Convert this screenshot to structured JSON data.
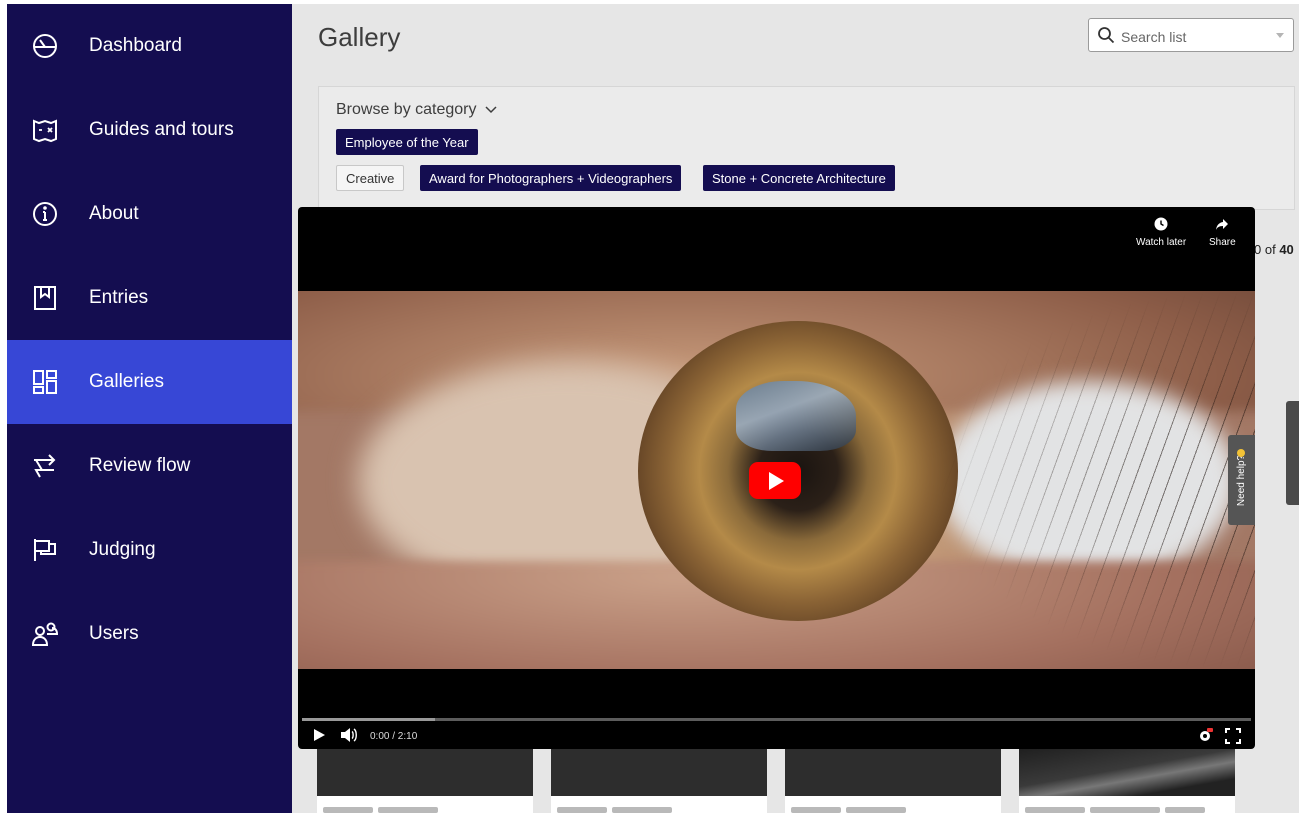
{
  "sidebar": {
    "items": [
      {
        "label": "Dashboard",
        "icon": "dashboard-gauge-icon",
        "active": false
      },
      {
        "label": "Guides and tours",
        "icon": "map-guide-icon",
        "active": false
      },
      {
        "label": "About",
        "icon": "info-circle-icon",
        "active": false
      },
      {
        "label": "Entries",
        "icon": "bookmark-entries-icon",
        "active": false
      },
      {
        "label": "Galleries",
        "icon": "grid-gallery-icon",
        "active": true
      },
      {
        "label": "Review flow",
        "icon": "review-flow-arrows-icon",
        "active": false
      },
      {
        "label": "Judging",
        "icon": "flag-icon",
        "active": false
      },
      {
        "label": "Users",
        "icon": "users-icon",
        "active": false
      }
    ],
    "colors": {
      "background": "#140d50",
      "active": "#3747d6"
    }
  },
  "header": {
    "title": "Gallery",
    "search_placeholder": "Search list"
  },
  "filters": {
    "browse_label": "Browse by category",
    "tags": [
      {
        "label": "Employee of the Year",
        "selected": true
      },
      {
        "label": "Creative",
        "selected": false
      },
      {
        "label": "Award for Photographers + Videographers",
        "selected": true
      },
      {
        "label": "Stone + Concrete Architecture",
        "selected": true
      }
    ]
  },
  "results": {
    "count_prefix": "0 of",
    "count_total": "40"
  },
  "video": {
    "watch_later_label": "Watch later",
    "share_label": "Share",
    "time_display": "0:00 / 2:10",
    "progress": 0,
    "need_help_label": "Need help?"
  }
}
